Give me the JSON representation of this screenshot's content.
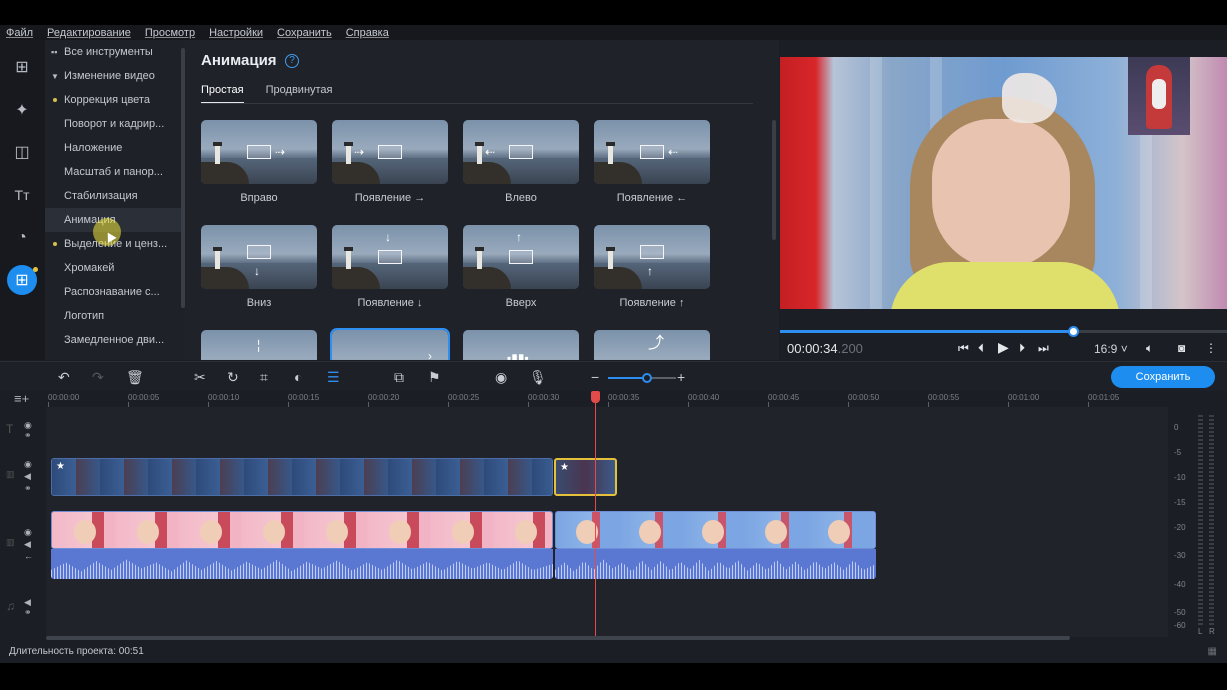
{
  "menu": [
    "Файл",
    "Редактирование",
    "Просмотр",
    "Настройки",
    "Сохранить",
    "Справка"
  ],
  "rail_icons": [
    "import-icon",
    "magic-wand-icon",
    "transitions-icon",
    "titles-icon",
    "stickers-icon",
    "more-tools-icon"
  ],
  "tools": {
    "all_tools": "Все инструменты",
    "section": "Изменение видео",
    "items": [
      "Коррекция цвета",
      "Поворот и кадрир...",
      "Наложение",
      "Масштаб и панор...",
      "Стабилизация",
      "Анимация",
      "Выделение и ценз...",
      "Хромакей",
      "Распознавание с...",
      "Логотип",
      "Замедленное дви..."
    ],
    "selected": "Анимация"
  },
  "animation_panel": {
    "title": "Анимация",
    "tabs": [
      "Простая",
      "Продвинутая"
    ],
    "active_tab": "Простая",
    "presets": [
      "Вправо",
      "Появление →",
      "Влево",
      "Появление ←",
      "Вниз",
      "Появление ↓",
      "Вверх",
      "Появление ↑"
    ]
  },
  "player": {
    "time_main": "00:00:34",
    "time_ms": ".200",
    "progress": 0.655,
    "aspect": "16:9"
  },
  "timeline": {
    "save_button": "Сохранить",
    "ruler": [
      "00:00:00",
      "00:00:05",
      "00:00:10",
      "00:00:15",
      "00:00:20",
      "00:00:25",
      "00:00:30",
      "00:00:35",
      "00:00:40",
      "00:00:45",
      "00:00:50",
      "00:00:55",
      "00:01:00",
      "00:01:05"
    ],
    "meter_labels": [
      "0",
      "-5",
      "-10",
      "-15",
      "-20",
      "-30",
      "-40",
      "-50",
      "-60"
    ],
    "meter_lr": [
      "L",
      "R"
    ]
  },
  "status": {
    "duration": "Длительность проекта: 00:51"
  },
  "colors": {
    "accent": "#1d8ef0",
    "playhead": "#e34b4b",
    "selected_clip_border": "#e5c03a"
  }
}
